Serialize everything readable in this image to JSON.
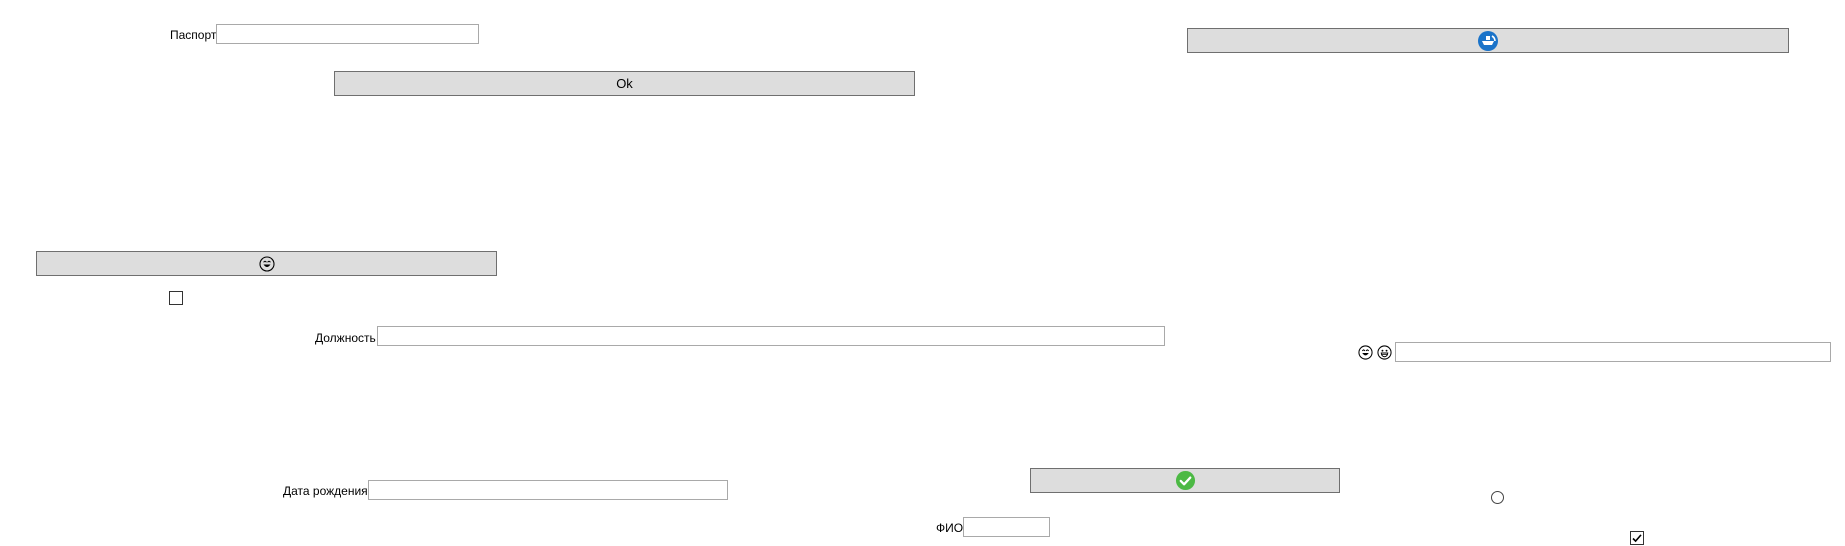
{
  "form": {
    "passport_label": "Паспорт",
    "passport_value": "",
    "ok_button_label": "Ok",
    "position_label": "Должность",
    "position_value": "",
    "birth_date_label": "Дата рождения",
    "birth_date_value": "",
    "fio_label": "ФИО",
    "fio_value": "",
    "emoji_field_value": "",
    "checkbox_left_checked": false,
    "checkbox_right_checked": true,
    "radio_selected": false
  },
  "icons": {
    "top_right_button_icon": "blue-ship-circle-icon",
    "left_button_icon": "laughing-face-icon",
    "emoji_pair": [
      "laughing-face-icon",
      "grinning-face-icon"
    ],
    "bottom_button_icon": "green-check-circle-icon"
  },
  "colors": {
    "button_bg": "#dddddd",
    "button_border": "#6f6f6f",
    "input_border": "#a9a9a9",
    "icon_blue": "#1a73c9",
    "icon_green": "#4cb944"
  }
}
